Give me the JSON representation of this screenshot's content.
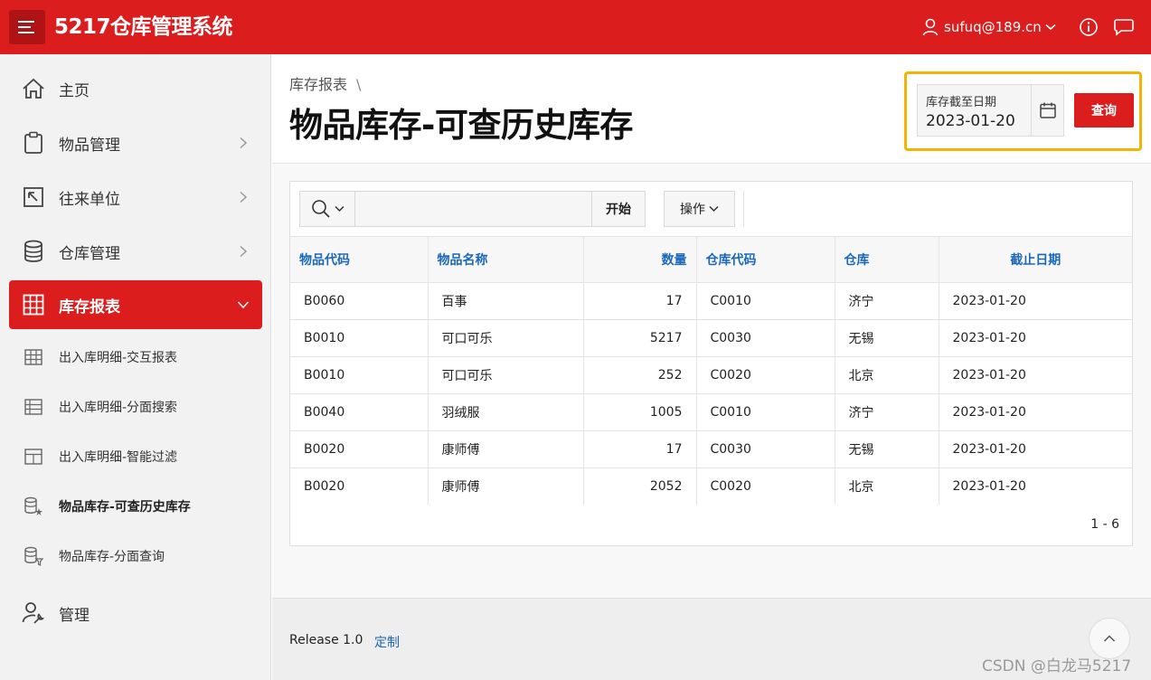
{
  "header": {
    "app_title": "5217仓库管理系统",
    "user_name": "sufuq@189.cn",
    "icons": [
      "menu-icon",
      "user-icon",
      "chevron-down-icon",
      "info-icon",
      "chat-icon"
    ]
  },
  "sidebar": {
    "items": [
      {
        "label": "主页",
        "icon": "home-icon"
      },
      {
        "label": "物品管理",
        "icon": "clipboard-icon"
      },
      {
        "label": "往来单位",
        "icon": "arrow-up-left-icon"
      },
      {
        "label": "仓库管理",
        "icon": "database-icon"
      },
      {
        "label": "库存报表",
        "icon": "table-icon"
      },
      {
        "label": "管理",
        "icon": "user-wrench-icon"
      }
    ],
    "sub_items": [
      {
        "label": "出入库明细-交互报表",
        "icon": "grid-icon"
      },
      {
        "label": "出入库明细-分面搜索",
        "icon": "list-table-icon"
      },
      {
        "label": "出入库明细-智能过滤",
        "icon": "layout-table-icon"
      },
      {
        "label": "物品库存-可查历史库存",
        "icon": "database-star-icon"
      },
      {
        "label": "物品库存-分面查询",
        "icon": "database-filter-icon"
      }
    ]
  },
  "page": {
    "breadcrumb": "库存报表",
    "breadcrumb_sep": "\\",
    "title": "物品库存-可查历史库存"
  },
  "filter": {
    "date_label": "库存截至日期",
    "date_value": "2023-01-20",
    "query_label": "查询"
  },
  "toolbar": {
    "search_placeholder": "",
    "go_label": "开始",
    "actions_label": "操作"
  },
  "table": {
    "columns": [
      "物品代码",
      "物品名称",
      "数量",
      "仓库代码",
      "仓库",
      "截止日期"
    ],
    "rows": [
      [
        "B0060",
        "百事",
        "17",
        "C0010",
        "济宁",
        "2023-01-20"
      ],
      [
        "B0010",
        "可口可乐",
        "5217",
        "C0030",
        "无锡",
        "2023-01-20"
      ],
      [
        "B0010",
        "可口可乐",
        "252",
        "C0020",
        "北京",
        "2023-01-20"
      ],
      [
        "B0040",
        "羽绒服",
        "1005",
        "C0010",
        "济宁",
        "2023-01-20"
      ],
      [
        "B0020",
        "康师傅",
        "17",
        "C0030",
        "无锡",
        "2023-01-20"
      ],
      [
        "B0020",
        "康师傅",
        "2052",
        "C0020",
        "北京",
        "2023-01-20"
      ]
    ],
    "pagination": "1 - 6"
  },
  "footer": {
    "release": "Release 1.0",
    "customize": "定制"
  },
  "watermark": "CSDN @白龙马5217",
  "colors": {
    "brand": "#db1d1d",
    "link": "#1b67b8",
    "highlight": "#f2b400"
  }
}
